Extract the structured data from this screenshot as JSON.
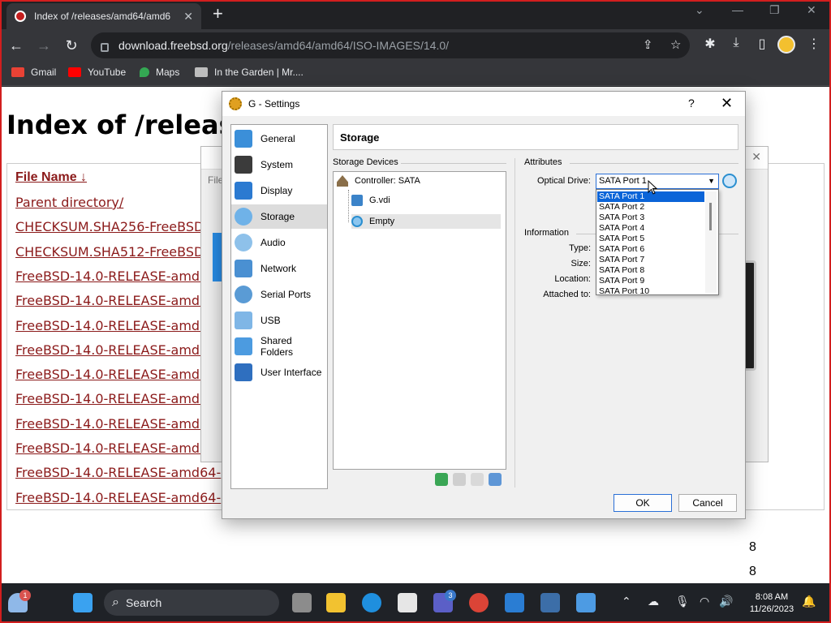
{
  "browser": {
    "tab_title": "Index of /releases/amd64/amd6",
    "new_tab": "+",
    "url_host": "download.freebsd.org",
    "url_path": "/releases/amd64/amd64/ISO-IMAGES/14.0/",
    "bookmarks": [
      "Gmail",
      "YouTube",
      "Maps",
      "In the Garden | Mr...."
    ],
    "colors": {
      "chrome_dark": "#202124",
      "toolbar": "#35363a",
      "link": "#8b1a1a"
    }
  },
  "page": {
    "title": "Index of /release",
    "column_header": "File Name  ↓",
    "files": [
      "Parent directory/",
      "CHECKSUM.SHA256-FreeBSD-",
      "CHECKSUM.SHA512-FreeBSD-",
      "FreeBSD-14.0-RELEASE-amd6",
      "FreeBSD-14.0-RELEASE-amd6",
      "FreeBSD-14.0-RELEASE-amd6",
      "FreeBSD-14.0-RELEASE-amd6",
      "FreeBSD-14.0-RELEASE-amd6",
      "FreeBSD-14.0-RELEASE-amd6",
      "FreeBSD-14.0-RELEASE-amd6",
      "FreeBSD-14.0-RELEASE-amd6",
      "FreeBSD-14.0-RELEASE-amd64-",
      "FreeBSD-14.0-RELEASE-amd64-"
    ],
    "size_tails": [
      "8",
      "8"
    ]
  },
  "vbox_manager": {
    "file_label": "File"
  },
  "dialog": {
    "title": "G - Settings",
    "help": "?",
    "close": "✕",
    "sections": [
      "General",
      "System",
      "Display",
      "Storage",
      "Audio",
      "Network",
      "Serial Ports",
      "USB",
      "Shared Folders",
      "User Interface"
    ],
    "selected_section": "Storage",
    "header": "Storage",
    "storage_devices_label": "Storage Devices",
    "tree": {
      "controller": "Controller: SATA",
      "children": [
        "G.vdi",
        "Empty"
      ]
    },
    "attributes": {
      "group_label": "Attributes",
      "optical_drive_label": "Optical Drive:",
      "optical_drive_value": "SATA Port 1",
      "options": [
        "SATA Port 1",
        "SATA Port 2",
        "SATA Port 3",
        "SATA Port 4",
        "SATA Port 5",
        "SATA Port 6",
        "SATA Port 7",
        "SATA Port 8",
        "SATA Port 9",
        "SATA Port 10"
      ]
    },
    "information": {
      "group_label": "Information",
      "type_label": "Type:",
      "size_label": "Size:",
      "location_label": "Location:",
      "attached_label": "Attached to:"
    },
    "ok": "OK",
    "cancel": "Cancel"
  },
  "taskbar": {
    "search": "Search",
    "time": "8:08 AM",
    "date": "11/26/2023",
    "weather_badge": "1",
    "teams_badge": "3"
  }
}
